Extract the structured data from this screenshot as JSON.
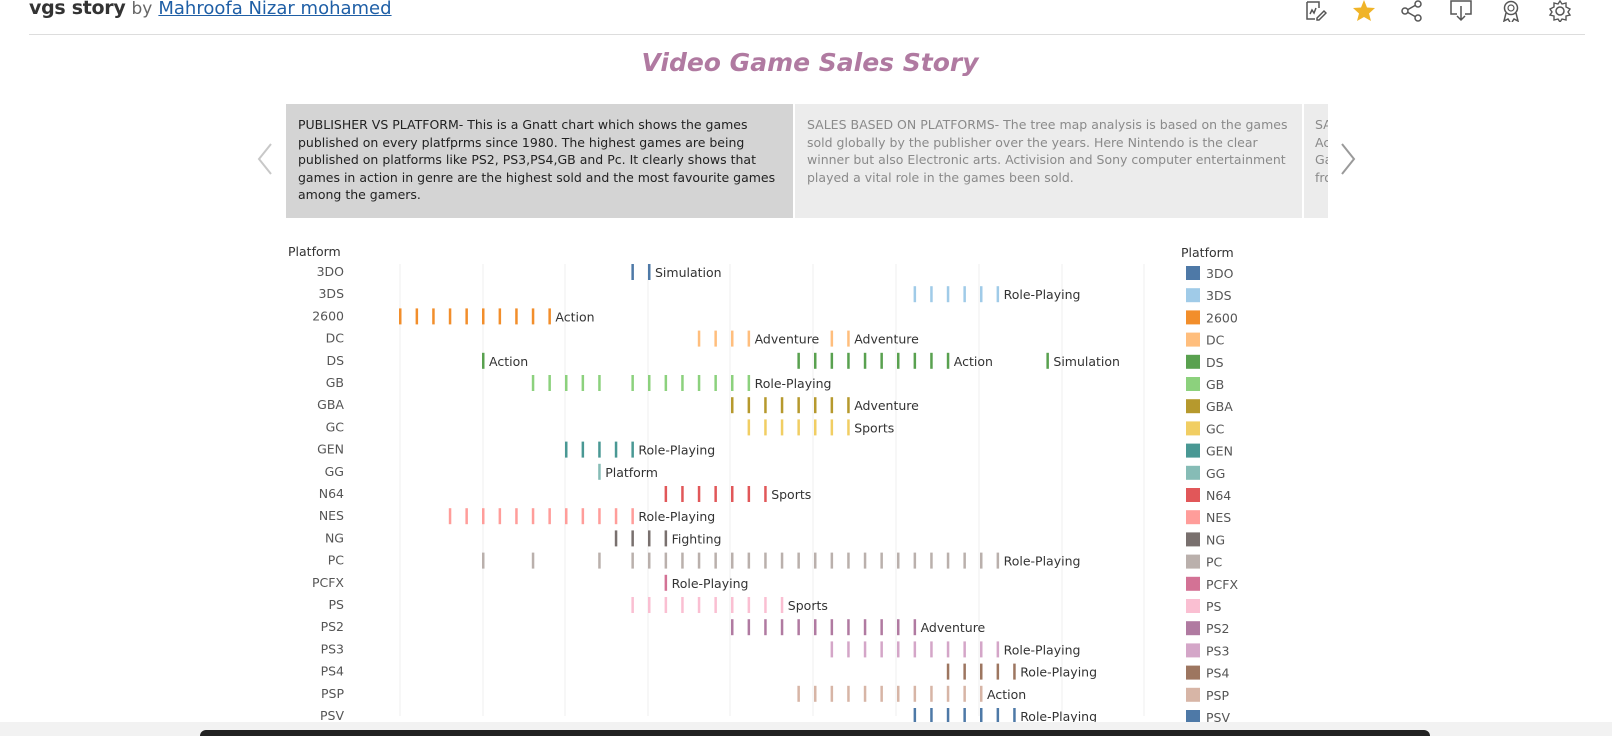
{
  "header": {
    "title": "vgs story",
    "by": "by",
    "author": "Mahroofa Nizar mohamed",
    "icons": [
      "edit-icon",
      "star-icon",
      "share-icon",
      "download-icon",
      "award-icon",
      "settings-icon"
    ]
  },
  "story_title": "Video Game Sales Story",
  "story_points": [
    {
      "text": "PUBLISHER VS PLATFORM- This is a Gnatt chart which shows the games published on every platfprms since 1980. The highest games are being published on platforms like PS2, PS3,PS4,GB and Pc. It clearly shows that games in action in genre are the highest sold and the most favourite games among the gamers."
    },
    {
      "text": "SALES BASED ON PLATFORMS- The tree map analysis is based on the games sold globally by the publisher over the years. Here Nintendo is the clear winner but also Electronic arts. Activision and Sony computer entertainment played a vital role in the games been sold."
    },
    {
      "text": "SA Ac Ga fro"
    }
  ],
  "colors": {
    "accent_title": "#b07aa1",
    "star": "#f0b428",
    "active_point": "#d4d4d4",
    "inactive_point": "#ececec"
  },
  "chart_data": {
    "type": "gantt",
    "row_header": "Platform",
    "legend_title": "Platform",
    "x_range": [
      1980,
      2016
    ],
    "rows": [
      {
        "platform": "3DO",
        "color": "#4e79a7",
        "years": [
          1994,
          1995
        ],
        "genre": "Simulation"
      },
      {
        "platform": "3DS",
        "color": "#a0cbe8",
        "years": [
          2011,
          2012,
          2013,
          2014,
          2015,
          2016
        ],
        "genre": "Role-Playing"
      },
      {
        "platform": "2600",
        "color": "#f28e2b",
        "years": [
          1980,
          1981,
          1982,
          1983,
          1984,
          1985,
          1986,
          1987,
          1988,
          1989
        ],
        "genre": "Action"
      },
      {
        "platform": "DC",
        "color": "#ffbe7d",
        "years": [
          1998,
          1999,
          2000,
          2001
        ],
        "genre": "Adventure",
        "years2": [
          2006,
          2007
        ],
        "genre2": "Adventure"
      },
      {
        "platform": "DS",
        "color": "#59a14f",
        "years": [
          1985
        ],
        "genre": "Action",
        "years2": [
          2004,
          2005,
          2006,
          2007,
          2008,
          2009,
          2010,
          2011,
          2012,
          2013
        ],
        "genre2": "Action",
        "years3": [
          2019
        ],
        "genre3": "Simulation"
      },
      {
        "platform": "GB",
        "color": "#8cd17d",
        "years": [
          1988,
          1989,
          1990,
          1991,
          1992,
          1994,
          1995,
          1996,
          1997,
          1998,
          1999,
          2000,
          2001
        ],
        "genre": "Role-Playing"
      },
      {
        "platform": "GBA",
        "color": "#b6992d",
        "years": [
          2000,
          2001,
          2002,
          2003,
          2004,
          2005,
          2006,
          2007
        ],
        "genre": "Adventure"
      },
      {
        "platform": "GC",
        "color": "#f1ce63",
        "years": [
          2001,
          2002,
          2003,
          2004,
          2005,
          2006,
          2007
        ],
        "genre": "Sports"
      },
      {
        "platform": "GEN",
        "color": "#499894",
        "years": [
          1990,
          1991,
          1992,
          1993,
          1994
        ],
        "genre": "Role-Playing"
      },
      {
        "platform": "GG",
        "color": "#86bcb6",
        "years": [
          1992
        ],
        "genre": "Platform"
      },
      {
        "platform": "N64",
        "color": "#e15759",
        "years": [
          1996,
          1997,
          1998,
          1999,
          2000,
          2001,
          2002
        ],
        "genre": "Sports"
      },
      {
        "platform": "NES",
        "color": "#ff9d9a",
        "years": [
          1983,
          1984,
          1985,
          1986,
          1987,
          1988,
          1989,
          1990,
          1991,
          1992,
          1993,
          1994
        ],
        "genre": "Role-Playing"
      },
      {
        "platform": "NG",
        "color": "#79706e",
        "years": [
          1993,
          1994,
          1995,
          1996
        ],
        "genre": "Fighting"
      },
      {
        "platform": "PC",
        "color": "#bab0ac",
        "years": [
          1985,
          1988,
          1992,
          1994,
          1995,
          1996,
          1997,
          1998,
          1999,
          2000,
          2001,
          2002,
          2003,
          2004,
          2005,
          2006,
          2007,
          2008,
          2009,
          2010,
          2011,
          2012,
          2013,
          2014,
          2015,
          2016
        ],
        "genre": "Role-Playing"
      },
      {
        "platform": "PCFX",
        "color": "#d37295",
        "years": [
          1996
        ],
        "genre": "Role-Playing"
      },
      {
        "platform": "PS",
        "color": "#fabfd2",
        "years": [
          1994,
          1995,
          1996,
          1997,
          1998,
          1999,
          2000,
          2001,
          2002,
          2003
        ],
        "genre": "Sports"
      },
      {
        "platform": "PS2",
        "color": "#b07aa1",
        "years": [
          2000,
          2001,
          2002,
          2003,
          2004,
          2005,
          2006,
          2007,
          2008,
          2009,
          2010,
          2011
        ],
        "genre": "Adventure"
      },
      {
        "platform": "PS3",
        "color": "#d4a6c8",
        "years": [
          2006,
          2007,
          2008,
          2009,
          2010,
          2011,
          2012,
          2013,
          2014,
          2015,
          2016
        ],
        "genre": "Role-Playing"
      },
      {
        "platform": "PS4",
        "color": "#9d7660",
        "years": [
          2013,
          2014,
          2015,
          2016,
          2017
        ],
        "genre": "Role-Playing"
      },
      {
        "platform": "PSP",
        "color": "#d7b5a6",
        "years": [
          2004,
          2005,
          2006,
          2007,
          2008,
          2009,
          2010,
          2011,
          2012,
          2013,
          2014,
          2015
        ],
        "genre": "Action"
      },
      {
        "platform": "PSV",
        "color": "#4e79a7",
        "years": [
          2011,
          2012,
          2013,
          2014,
          2015,
          2016,
          2017
        ],
        "genre": "Role-Playing"
      }
    ]
  }
}
